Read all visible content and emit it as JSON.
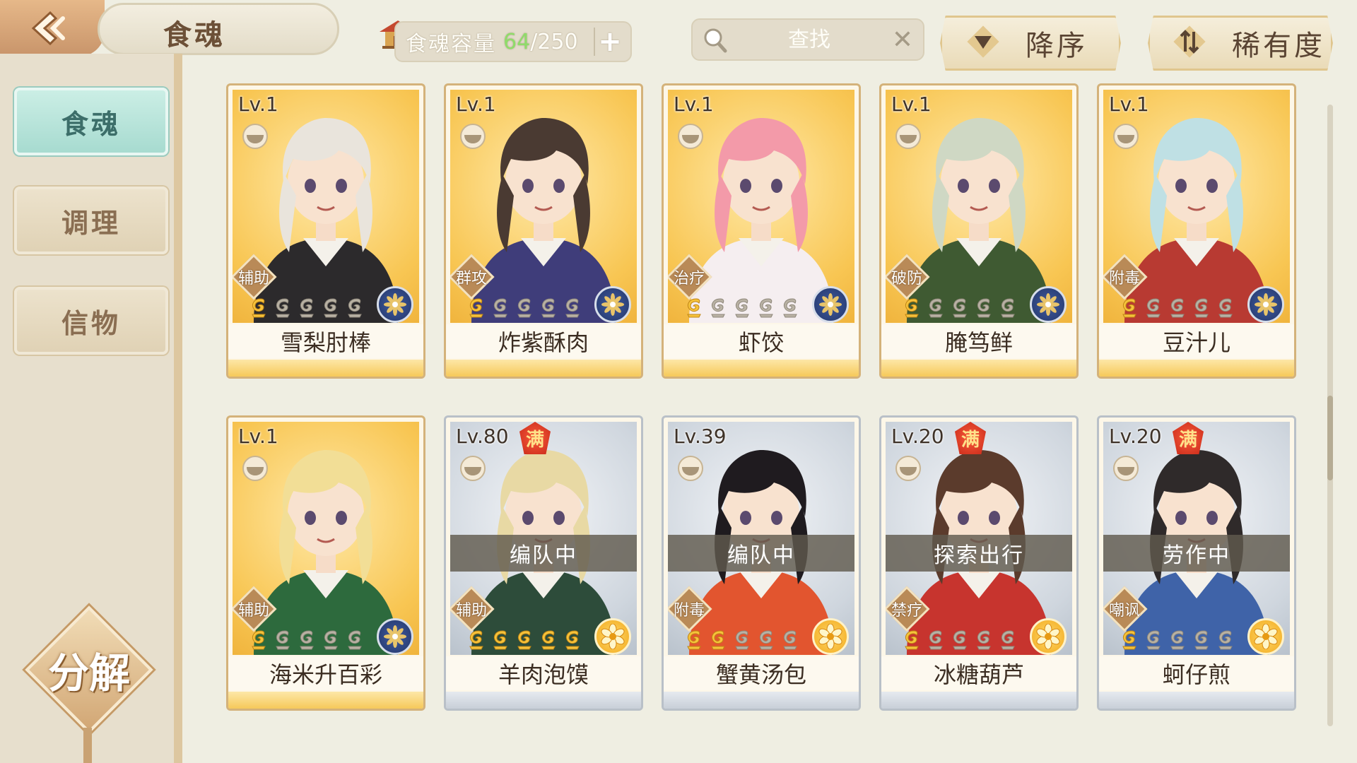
{
  "header": {
    "title": "食魂",
    "capacity": {
      "label": "食魂容量",
      "current": "64",
      "max": "/250",
      "add_label": "+"
    },
    "search": {
      "placeholder": "查找",
      "clear_label": "✕"
    },
    "sort_order_label": "降序",
    "sort_key_label": "稀有度"
  },
  "sidebar": {
    "tabs": [
      {
        "label": "食魂",
        "active": true
      },
      {
        "label": "调理",
        "active": false
      },
      {
        "label": "信物",
        "active": false
      }
    ],
    "decompose_label": "分解"
  },
  "cards": [
    {
      "level": "Lv.1",
      "name": "雪梨肘棒",
      "role": "辅助",
      "stars_lit": 1,
      "element": "water-emblem",
      "frame": "gold",
      "full": false,
      "status": "",
      "hair": "#e9e4dc",
      "outfit": "#2c2a2c"
    },
    {
      "level": "Lv.1",
      "name": "炸紫酥肉",
      "role": "群攻",
      "stars_lit": 1,
      "element": "water-emblem",
      "frame": "gold",
      "full": false,
      "status": "",
      "hair": "#4a3a32",
      "outfit": "#3f3d7a"
    },
    {
      "level": "Lv.1",
      "name": "虾饺",
      "role": "治疗",
      "stars_lit": 1,
      "element": "water-emblem",
      "frame": "gold",
      "full": false,
      "status": "",
      "hair": "#f39aa9",
      "outfit": "#f5eef0"
    },
    {
      "level": "Lv.1",
      "name": "腌笃鲜",
      "role": "破防",
      "stars_lit": 1,
      "element": "water-emblem",
      "frame": "gold",
      "full": false,
      "status": "",
      "hair": "#cfd8c4",
      "outfit": "#3f5a32"
    },
    {
      "level": "Lv.1",
      "name": "豆汁儿",
      "role": "附毒",
      "stars_lit": 1,
      "element": "water-emblem",
      "frame": "gold",
      "full": false,
      "status": "",
      "hair": "#bfe0e4",
      "outfit": "#b83a32"
    },
    {
      "level": "Lv.1",
      "name": "海米升百彩",
      "role": "辅助",
      "stars_lit": 1,
      "element": "water-emblem",
      "frame": "gold",
      "full": false,
      "status": "",
      "hair": "#f2de96",
      "outfit": "#2d6a3d"
    },
    {
      "level": "Lv.80",
      "name": "羊肉泡馍",
      "role": "辅助",
      "stars_lit": 5,
      "element": "flower-emblem",
      "frame": "silver",
      "full": true,
      "full_label": "满",
      "status": "编队中",
      "hair": "#e8d9a4",
      "outfit": "#2d4c3a"
    },
    {
      "level": "Lv.39",
      "name": "蟹黄汤包",
      "role": "附毒",
      "stars_lit": 2,
      "element": "flower-emblem",
      "frame": "silver",
      "full": false,
      "status": "编队中",
      "hair": "#1f1b1f",
      "outfit": "#e2552f"
    },
    {
      "level": "Lv.20",
      "name": "冰糖葫芦",
      "role": "禁疗",
      "stars_lit": 1,
      "element": "flower-emblem",
      "frame": "silver",
      "full": true,
      "full_label": "满",
      "status": "探索出行",
      "hair": "#5b3b2c",
      "outfit": "#c7342e"
    },
    {
      "level": "Lv.20",
      "name": "蚵仔煎",
      "role": "嘲讽",
      "stars_lit": 1,
      "element": "flower-emblem",
      "frame": "silver",
      "full": true,
      "full_label": "满",
      "status": "劳作中",
      "hair": "#2f2a2a",
      "outfit": "#3f63a8"
    }
  ],
  "colors": {
    "accent_teal": "#a7dbd0",
    "gold_frame": "#f8c653",
    "silver_frame": "#cfd6de",
    "capacity_current": "#8fdc6a"
  }
}
